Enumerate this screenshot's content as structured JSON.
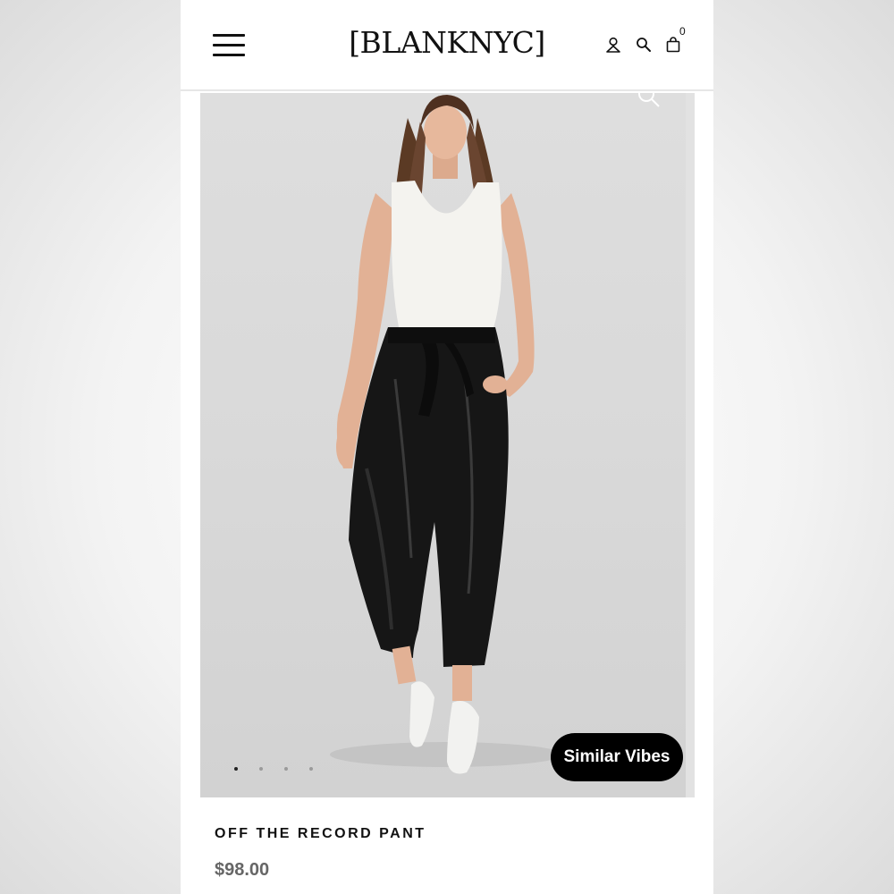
{
  "header": {
    "logo": "[BLANKNYC]",
    "menu_icon": "hamburger-menu-icon",
    "account_icon": "user-icon",
    "search_icon": "search-icon",
    "cart_icon": "shopping-bag-icon",
    "cart_count": "0"
  },
  "product": {
    "image_description": "model-photo",
    "zoom_icon": "zoom-icon",
    "carousel_total": 4,
    "carousel_active": 1,
    "similar_label": "Similar Vibes",
    "name": "OFF THE RECORD PANT",
    "price": "$98.00"
  },
  "colors": {
    "background": "#ffffff",
    "image_bg": "#dcdcdc",
    "button_bg": "#000000",
    "button_text": "#ffffff",
    "price_text": "#666666"
  }
}
